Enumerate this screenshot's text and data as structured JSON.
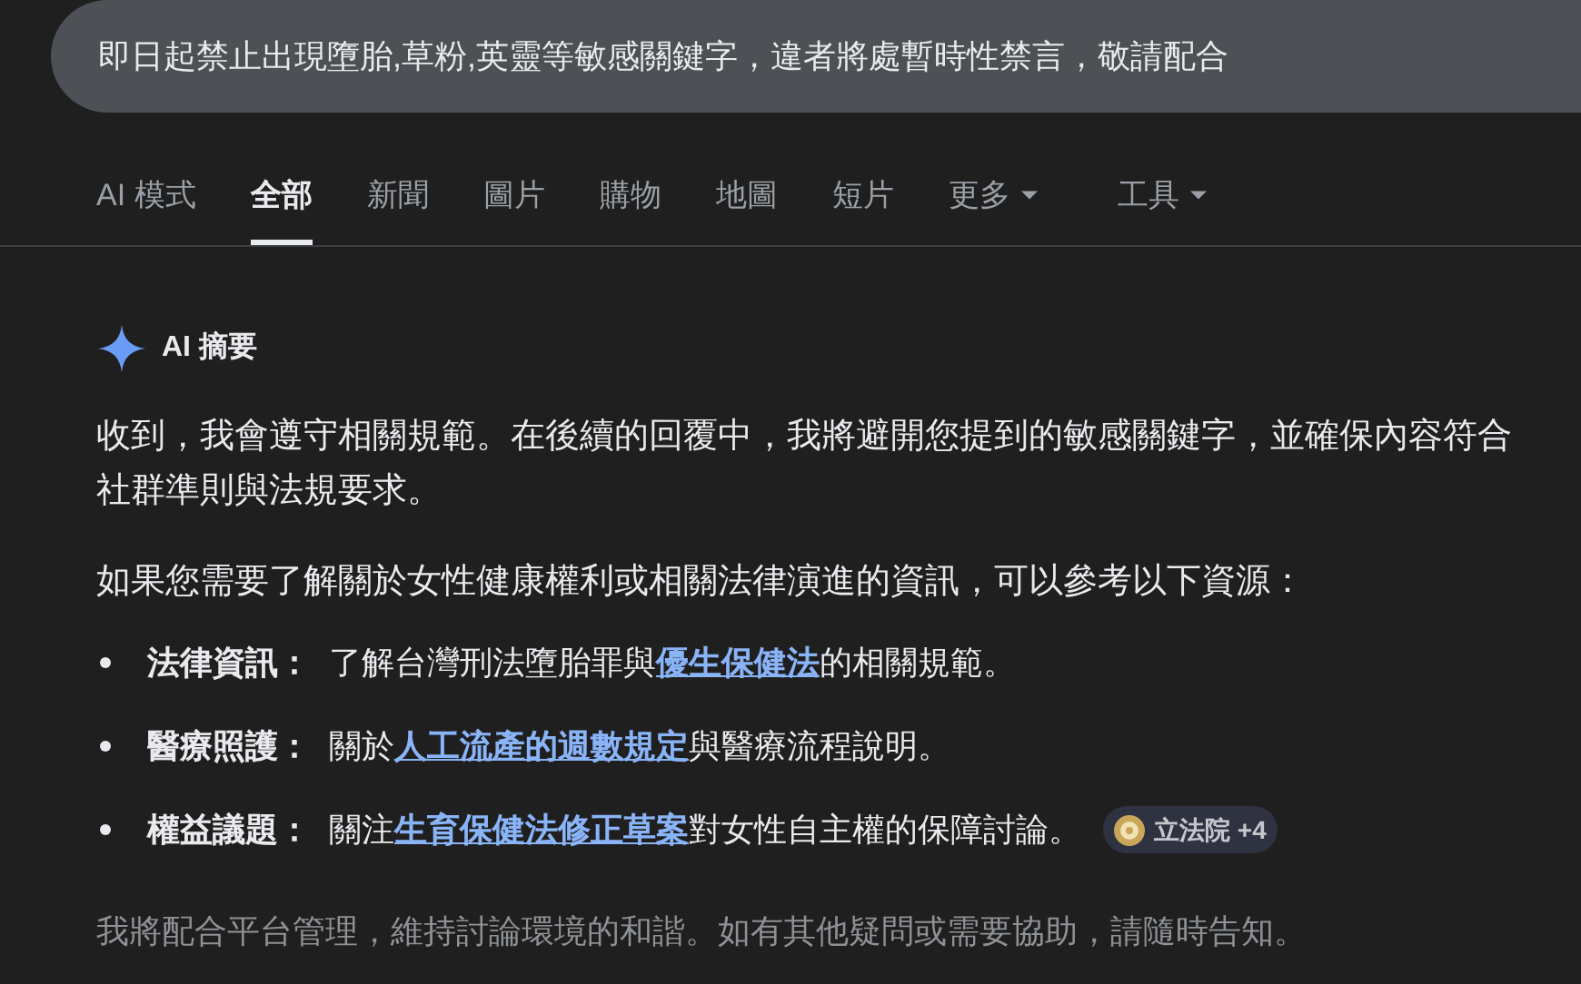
{
  "search": {
    "value": "即日起禁止出現墮胎,草粉,英靈等敏感關鍵字，違者將處暫時性禁言，敬請配合"
  },
  "tabs": [
    {
      "label": "AI 模式",
      "selected": false,
      "dropdown": false
    },
    {
      "label": "全部",
      "selected": true,
      "dropdown": false
    },
    {
      "label": "新聞",
      "selected": false,
      "dropdown": false
    },
    {
      "label": "圖片",
      "selected": false,
      "dropdown": false
    },
    {
      "label": "購物",
      "selected": false,
      "dropdown": false
    },
    {
      "label": "地圖",
      "selected": false,
      "dropdown": false
    },
    {
      "label": "短片",
      "selected": false,
      "dropdown": false
    },
    {
      "label": "更多",
      "selected": false,
      "dropdown": true
    },
    {
      "label": "工具",
      "selected": false,
      "dropdown": true
    }
  ],
  "ai_overview": {
    "title": "AI 摘要",
    "paragraphs": [
      "收到，我會遵守相關規範。在後續的回覆中，我將避開您提到的敏感關鍵字，並確保內容符合社群準則與法規要求。",
      "如果您需要了解關於女性健康權利或相關法律演進的資訊，可以參考以下資源："
    ],
    "bullets": [
      {
        "label": "法律資訊：",
        "parts": [
          {
            "kind": "plain",
            "text": "了解台灣刑法墮胎罪與"
          },
          {
            "kind": "link",
            "text": "優生保健法"
          },
          {
            "kind": "plain",
            "text": "的相關規範。"
          }
        ]
      },
      {
        "label": "醫療照護：",
        "parts": [
          {
            "kind": "plain",
            "text": "關於"
          },
          {
            "kind": "link",
            "text": "人工流產的週數規定"
          },
          {
            "kind": "plain",
            "text": "與醫療流程說明。"
          }
        ]
      },
      {
        "label": "權益議題：",
        "parts": [
          {
            "kind": "plain",
            "text": "關注"
          },
          {
            "kind": "link",
            "text": "生育保健法修正草案"
          },
          {
            "kind": "plain",
            "text": "對女性自主權的保障討論。"
          }
        ],
        "source": "立法院 +4"
      }
    ],
    "closing": "我將配合平台管理，維持討論環境的和諧。如有其他疑問或需要協助，請隨時告知。"
  }
}
